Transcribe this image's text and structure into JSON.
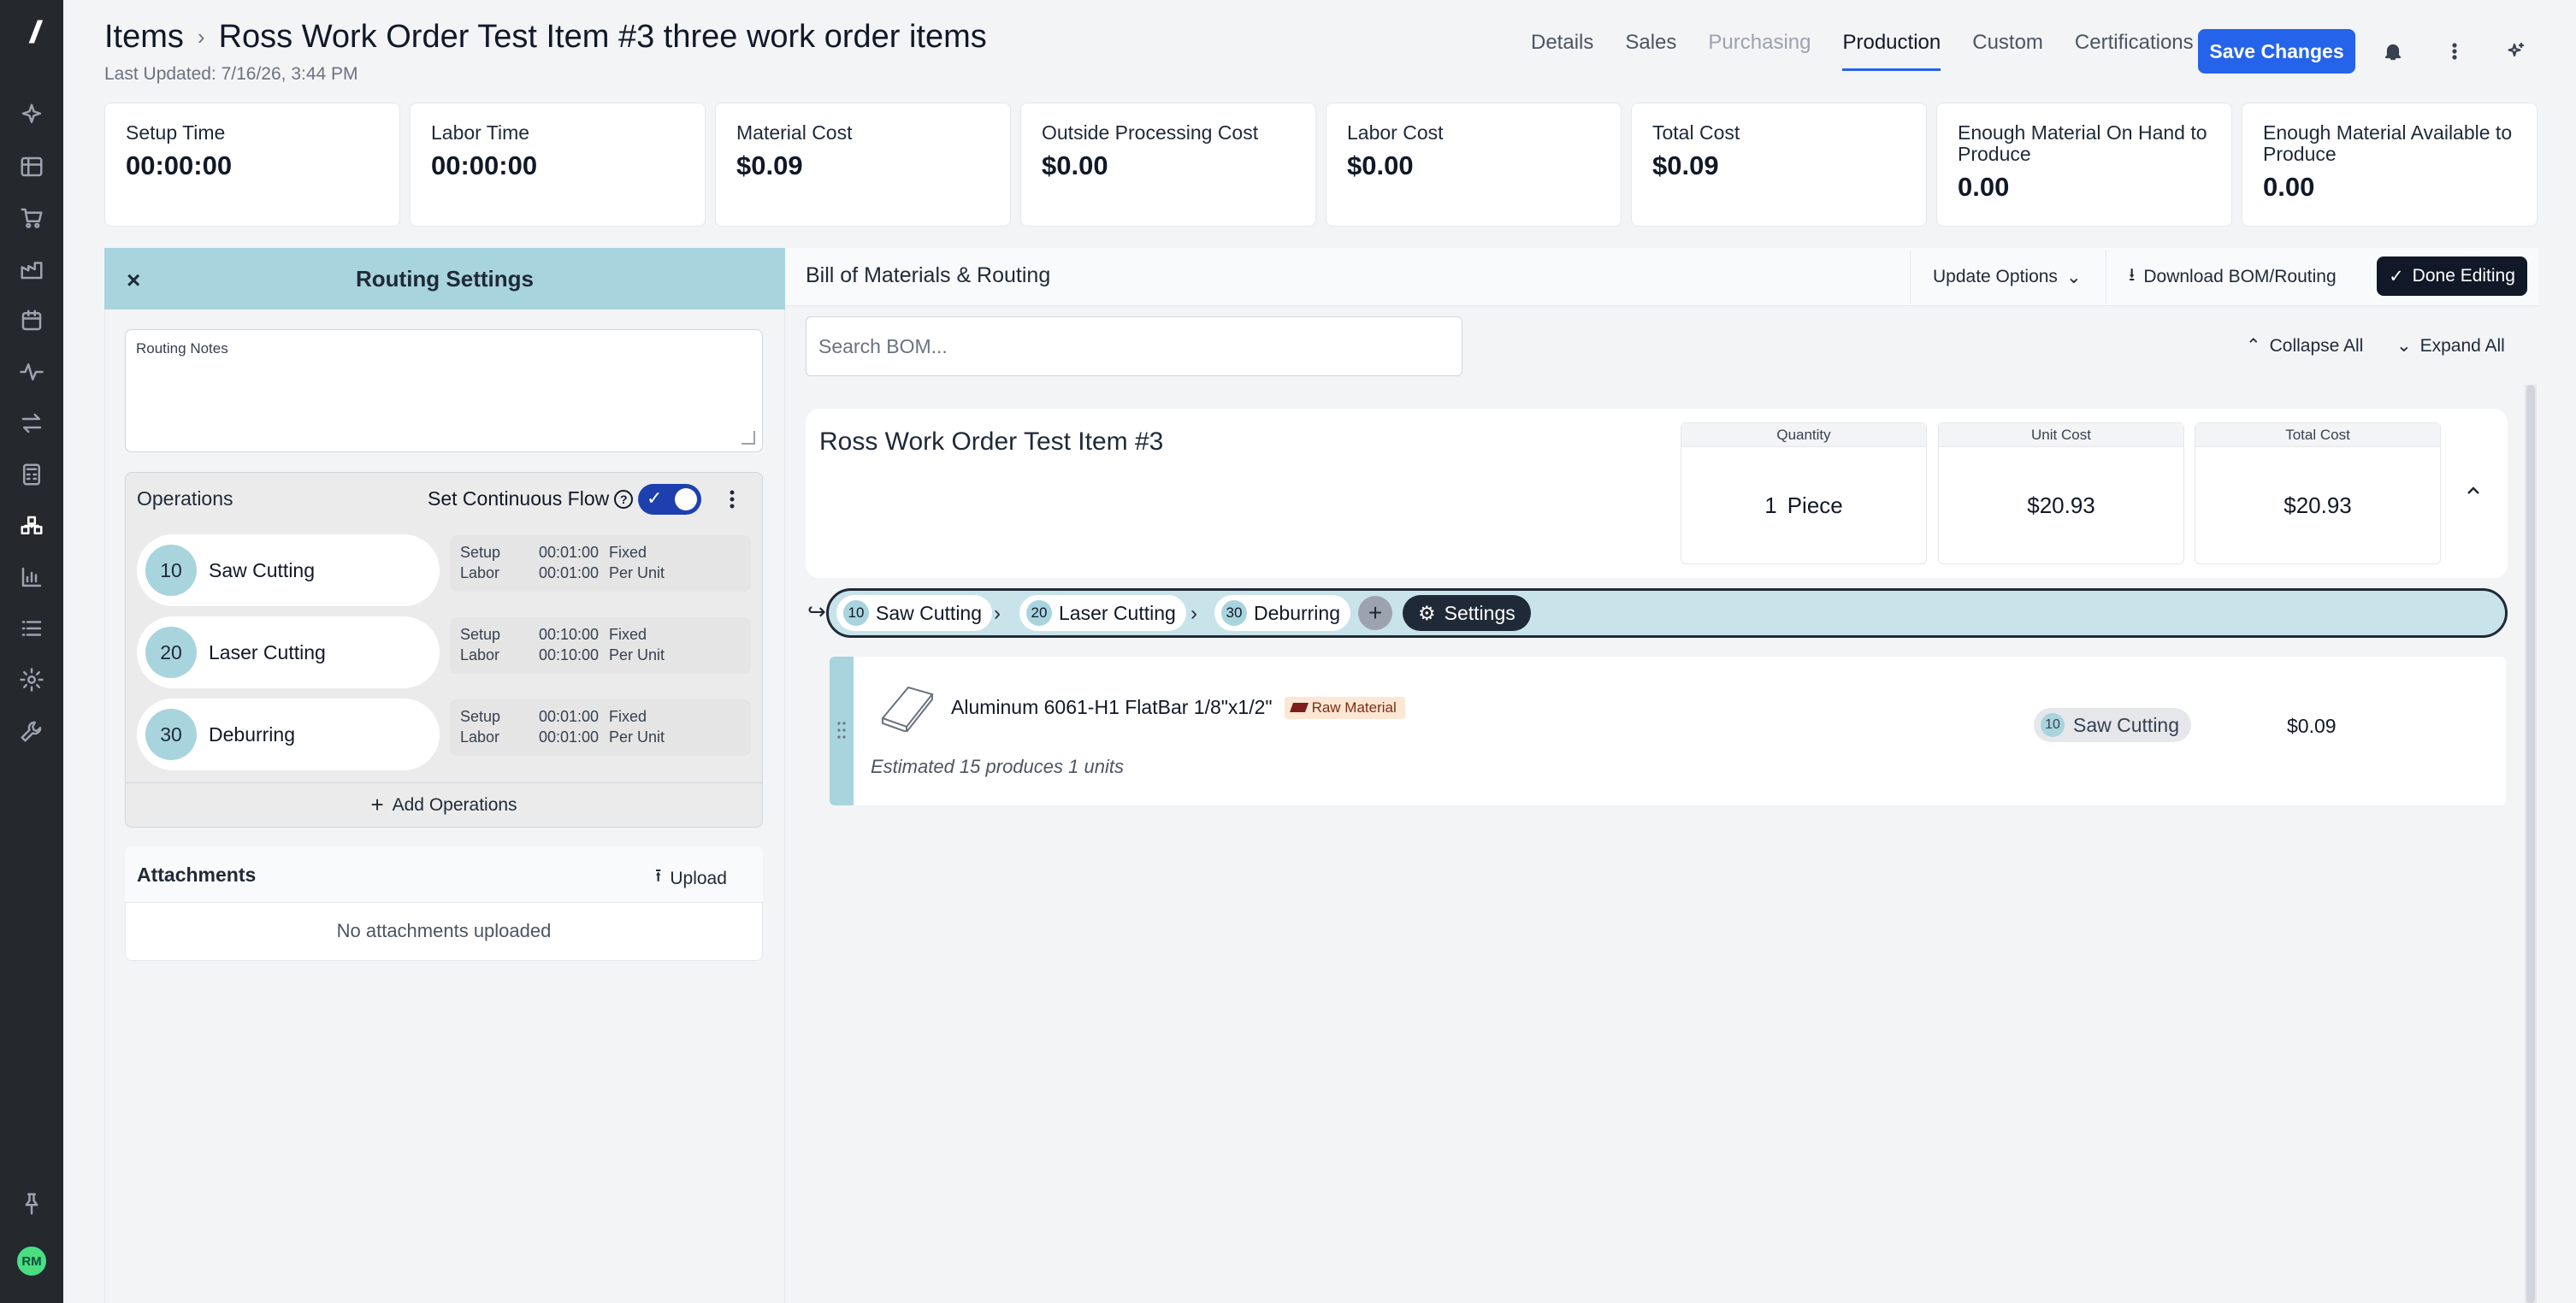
{
  "header": {
    "breadcrumb_root": "Items",
    "item_title": "Ross Work Order Test Item #3 three work order items",
    "last_updated": "Last Updated: 7/16/26, 3:44 PM",
    "tabs": [
      {
        "label": "Details",
        "state": "normal"
      },
      {
        "label": "Sales",
        "state": "normal"
      },
      {
        "label": "Purchasing",
        "state": "disabled"
      },
      {
        "label": "Production",
        "state": "active"
      },
      {
        "label": "Custom",
        "state": "normal"
      },
      {
        "label": "Certifications",
        "state": "normal"
      }
    ],
    "save_label": "Save Changes",
    "accent_color": "#2563eb"
  },
  "sidebar": {
    "avatar_initials": "RM",
    "icons": [
      "sparkle-icon",
      "table-icon",
      "cart-icon",
      "factory-icon",
      "calendar-icon",
      "activity-icon",
      "transfer-icon",
      "calculator-icon",
      "routing-icon",
      "chart-icon",
      "list-icon",
      "gear-icon",
      "wrench-icon",
      "pin-icon"
    ]
  },
  "stats": [
    {
      "label": "Setup Time",
      "value": "00:00:00"
    },
    {
      "label": "Labor Time",
      "value": "00:00:00"
    },
    {
      "label": "Material Cost",
      "value": "$0.09"
    },
    {
      "label": "Outside Processing Cost",
      "value": "$0.00"
    },
    {
      "label": "Labor Cost",
      "value": "$0.00"
    },
    {
      "label": "Total Cost",
      "value": "$0.09"
    },
    {
      "label": "Enough Material On Hand to Produce",
      "value": "0.00"
    },
    {
      "label": "Enough Material Available to Produce",
      "value": "0.00"
    }
  ],
  "routing_settings": {
    "title": "Routing Settings",
    "close": "×",
    "notes_placeholder": "Routing Notes",
    "operations_title": "Operations",
    "continuous_flow_label": "Set Continuous Flow",
    "continuous_flow_on": true,
    "operations": [
      {
        "num": "10",
        "name": "Saw Cutting",
        "setup_label": "Setup",
        "setup_time": "00:01:00",
        "setup_type": "Fixed",
        "labor_label": "Labor",
        "labor_time": "00:01:00",
        "labor_type": "Per Unit"
      },
      {
        "num": "20",
        "name": "Laser Cutting",
        "setup_label": "Setup",
        "setup_time": "00:10:00",
        "setup_type": "Fixed",
        "labor_label": "Labor",
        "labor_time": "00:10:00",
        "labor_type": "Per Unit"
      },
      {
        "num": "30",
        "name": "Deburring",
        "setup_label": "Setup",
        "setup_time": "00:01:00",
        "setup_type": "Fixed",
        "labor_label": "Labor",
        "labor_time": "00:01:00",
        "labor_type": "Per Unit"
      }
    ],
    "add_operations": "Add Operations",
    "attachments_title": "Attachments",
    "upload_label": "Upload",
    "no_attachments": "No attachments uploaded"
  },
  "bom": {
    "title": "Bill of Materials & Routing",
    "update_options": "Update Options",
    "download": "Download BOM/Routing",
    "done_editing": "Done Editing",
    "search_placeholder": "Search BOM...",
    "collapse_all": "Collapse All",
    "expand_all": "Expand All",
    "root": {
      "name": "Ross Work Order Test Item #3",
      "quantity_header": "Quantity",
      "quantity_value": "1",
      "quantity_unit": "Piece",
      "unit_cost_header": "Unit Cost",
      "unit_cost": "$20.93",
      "total_cost_header": "Total Cost",
      "total_cost": "$20.93"
    },
    "route": [
      {
        "num": "10",
        "name": "Saw Cutting"
      },
      {
        "num": "20",
        "name": "Laser Cutting"
      },
      {
        "num": "30",
        "name": "Deburring"
      }
    ],
    "route_settings": "Settings",
    "material": {
      "name": "Aluminum 6061-H1 FlatBar 1/8\"x1/2\"",
      "badge": "Raw Material",
      "note": "Estimated 15 produces 1 units",
      "op_num": "10",
      "op_name": "Saw Cutting",
      "cost": "$0.09"
    }
  }
}
